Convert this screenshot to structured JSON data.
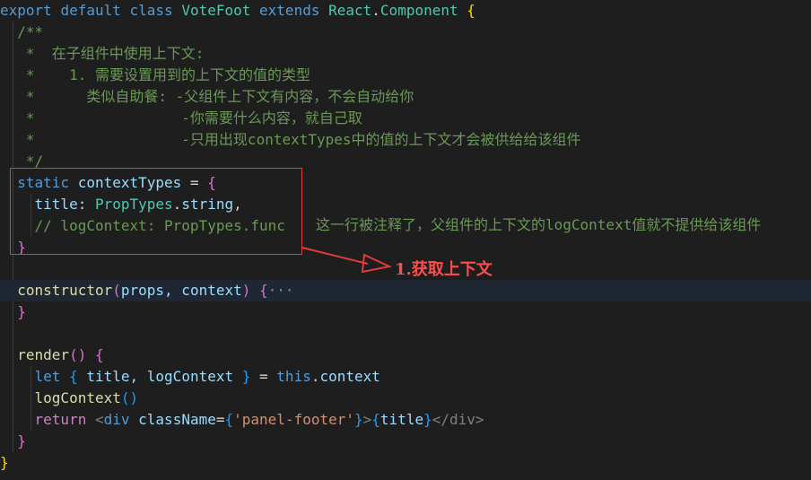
{
  "code": {
    "l1": {
      "export": "export",
      "default": "default",
      "class": "class",
      "name": "VoteFoot",
      "extends": "extends",
      "react": "React",
      "dot": ".",
      "component": "Component",
      "brace": "{"
    },
    "l2": "/**",
    "l3": "*  在子组件中使用上下文:",
    "l4": "*    1. 需要设置用到的上下文的值的类型",
    "l5": "*      类似自助餐: -父组件上下文有内容，不会自动给你",
    "l6": "*                 -你需要什么内容，就自己取",
    "l7": "*                 -只用出现contextTypes中的值的上下文才会被供给给该组件",
    "l8": "*/",
    "l9": {
      "static": "static",
      "prop": "contextTypes",
      "eq": " = ",
      "brace": "{"
    },
    "l10": {
      "key": "title",
      "colon": ": ",
      "obj": "PropTypes",
      "dot": ".",
      "type": "string",
      "comma": ","
    },
    "l11": "// logContext: PropTypes.func",
    "l12": "}",
    "l14": {
      "fn": "constructor",
      "open": "(",
      "args": "props, context",
      "close": ")",
      "brace": "{",
      "fold": "···"
    },
    "l15": "}",
    "l17": {
      "fn": "render",
      "parens": "()",
      "brace": "{"
    },
    "l18": {
      "let": "let",
      "open": "{",
      "vars": " title, logContext ",
      "close": "}",
      "eq": " = ",
      "this": "this",
      "dot": ".",
      "ctx": "context"
    },
    "l19": {
      "fn": "logContext",
      "parens": "()"
    },
    "l20": {
      "return": "return",
      "lt": "<",
      "tag": "div",
      "attr": "className",
      "eq": "=",
      "ob": "{",
      "str": "'panel-footer'",
      "cb": "}",
      "gt": ">",
      "ob2": "{",
      "var": "title",
      "cb2": "}",
      "endtag": "</div>"
    },
    "l21": "}",
    "l22": "}"
  },
  "annotations": {
    "side_note": "这一行被注释了，父组件的上下文的logContext值就不提供给该组件",
    "label": "1.获取上下文"
  },
  "colors": {
    "background": "#1e1e1e",
    "annotation_red": "#e23b3b",
    "comment": "#6a9955"
  }
}
